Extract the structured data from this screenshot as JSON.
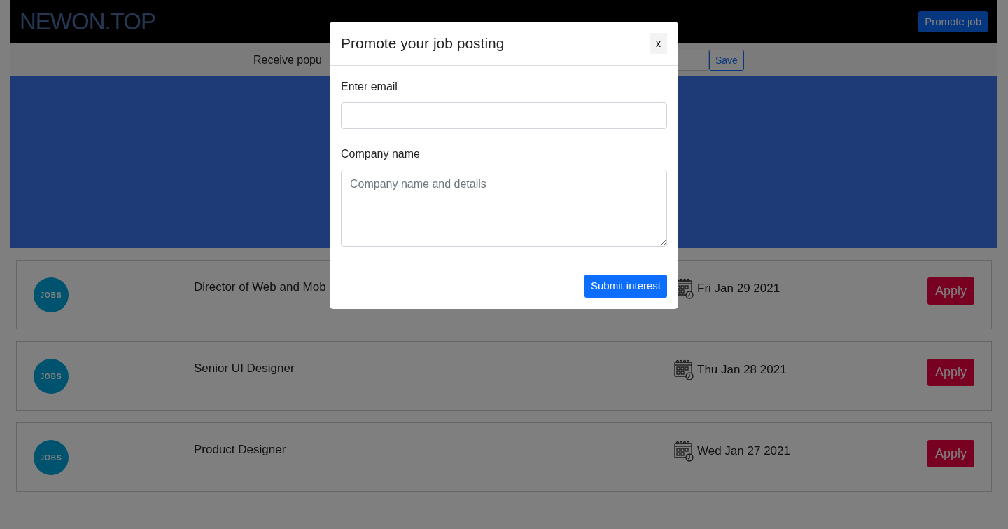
{
  "navbar": {
    "logo": "NEWON.TOP",
    "promote_button": "Promote job"
  },
  "subscribe_bar": {
    "text": "Receive popu",
    "save_button": "Save"
  },
  "jobs": [
    {
      "logo": "JOBS",
      "title": "Director of Web and Mob",
      "date": "Fri Jan 29 2021",
      "apply": "Apply"
    },
    {
      "logo": "JOBS",
      "title": "Senior UI Designer",
      "date": "Thu Jan 28 2021",
      "apply": "Apply"
    },
    {
      "logo": "JOBS",
      "title": "Product Designer",
      "date": "Wed Jan 27 2021",
      "apply": "Apply"
    }
  ],
  "modal": {
    "title": "Promote your job posting",
    "close": "x",
    "fields": [
      {
        "kind": "input",
        "label": "Enter email"
      },
      {
        "kind": "textarea",
        "label": "Company name",
        "placeholder": "Company name and details"
      }
    ],
    "submit": "Submit interest"
  }
}
